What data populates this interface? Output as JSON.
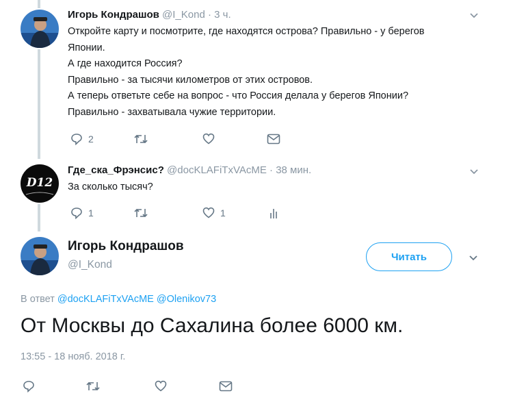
{
  "tweet1": {
    "author_name": "Игорь Кондрашов",
    "author_handle": "@I_Kond",
    "time": " · 3 ч.",
    "lines": [
      "Откройте карту и посмотрите, где находятся острова? Правильно - у берегов",
      "Японии.",
      "А где находится Россия?",
      "Правильно - за тысячи километров от этих островов.",
      "А теперь ответьте себе на вопрос - что Россия делала у берегов Японии?",
      "Правильно - захватывала чужие территории."
    ],
    "reply_count": "2",
    "retweet_count": "",
    "like_count": ""
  },
  "tweet2": {
    "author_name": "Где_ска_Фрэнсис?",
    "author_handle": "@docKLAFiTxVAcME",
    "time": " · 38 мин.",
    "text": "За сколько тысяч?",
    "reply_count": "1",
    "retweet_count": "",
    "like_count": "1",
    "avatar_text": "D12"
  },
  "main_tweet": {
    "author_name": "Игорь Кондрашов",
    "author_handle": "@I_Kond",
    "follow_label": "Читать",
    "reply_prefix": "В ответ",
    "mention1": "@docKLAFiTxVAcME",
    "mention2": "@Olenikov73",
    "text": "От Москвы до Сахалина более 6000 км.",
    "timestamp": "13:55 - 18 нояб. 2018 г."
  },
  "colors": {
    "accent": "#1da1f2",
    "muted": "#8a97a3",
    "thread_line": "#cfd9de"
  }
}
